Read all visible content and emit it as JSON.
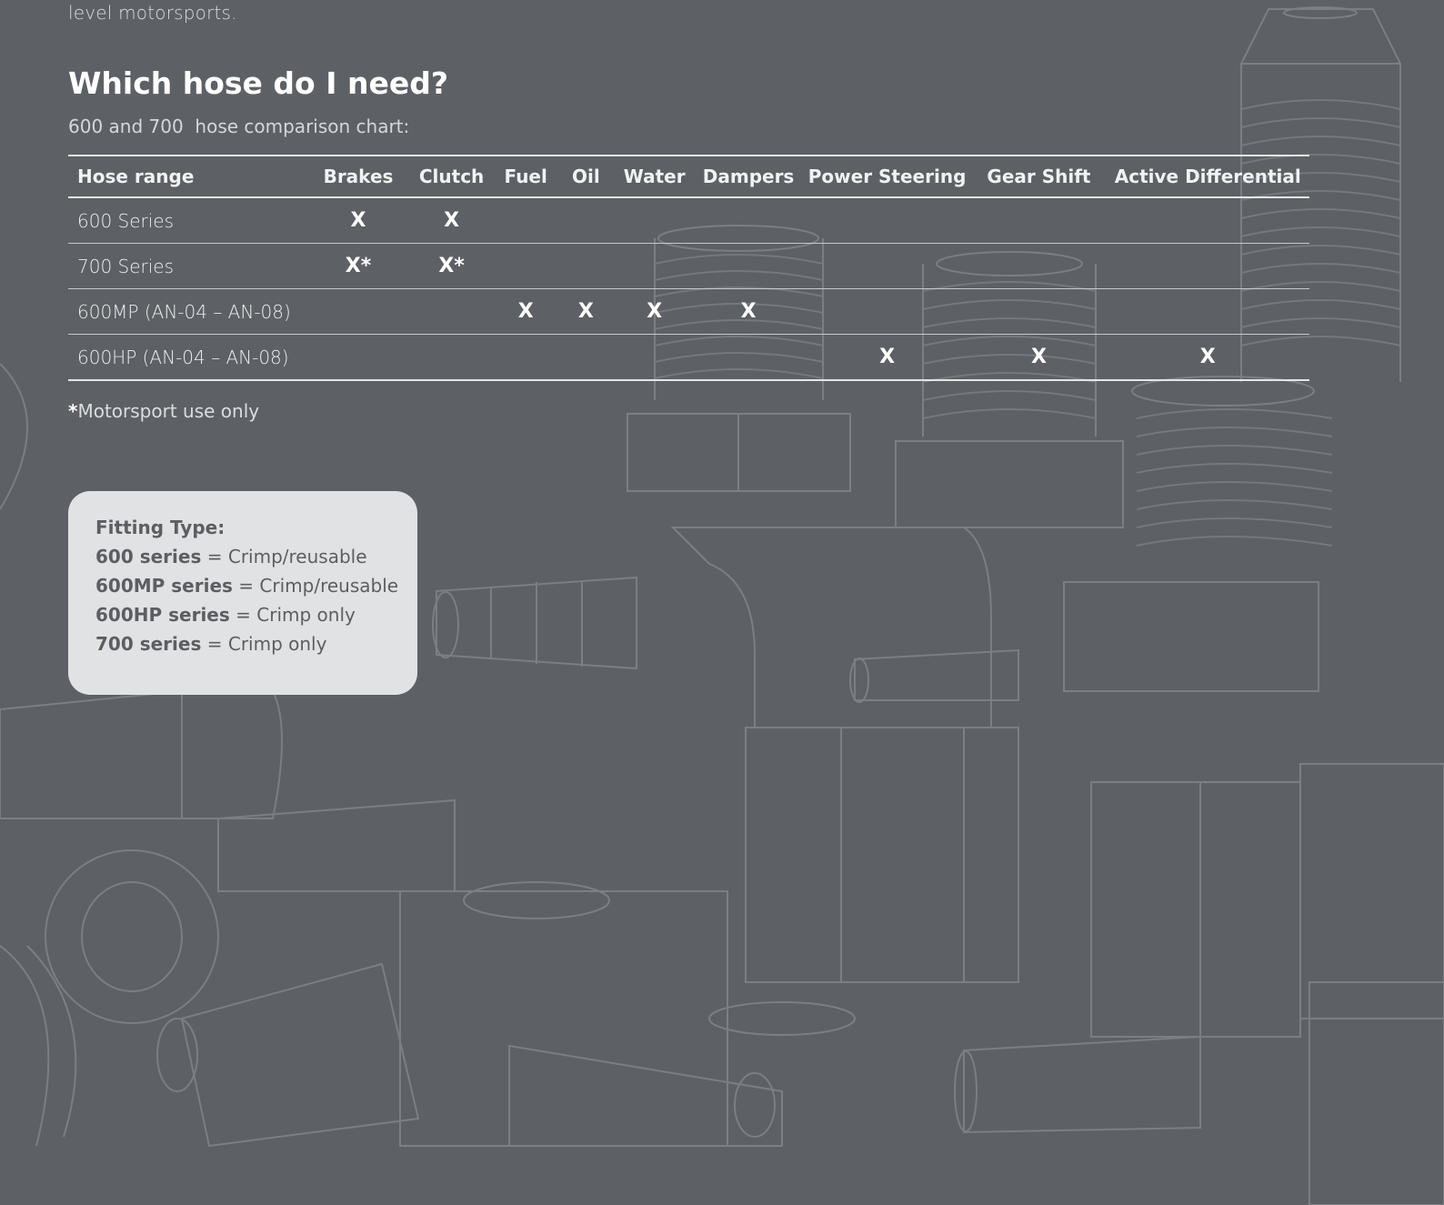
{
  "intro_text": "level motorsports.",
  "heading": "Which hose do I need?",
  "subheading": "600 and 700  hose comparison chart:",
  "table": {
    "columns": [
      "Hose range",
      "Brakes",
      "Clutch",
      "Fuel",
      "Oil",
      "Water",
      "Dampers",
      "Power Steering",
      "Gear Shift",
      "Active Differential"
    ],
    "rows": [
      {
        "name": "600 Series",
        "cells": [
          "X",
          "X",
          "",
          "",
          "",
          "",
          "",
          "",
          ""
        ]
      },
      {
        "name": "700 Series",
        "cells": [
          "X*",
          "X*",
          "",
          "",
          "",
          "",
          "",
          "",
          ""
        ]
      },
      {
        "name": "600MP (AN-04 – AN-08)",
        "cells": [
          "",
          "",
          "X",
          "X",
          "X",
          "X",
          "",
          "",
          ""
        ]
      },
      {
        "name": "600HP (AN-04 – AN-08)",
        "cells": [
          "",
          "",
          "",
          "",
          "",
          "",
          "X",
          "X",
          "X"
        ]
      }
    ]
  },
  "footnote": {
    "star": "*",
    "text": "Motorsport use only"
  },
  "fitting_box": {
    "title": "Fitting Type:",
    "items": [
      {
        "series": "600 series",
        "type": "Crimp/reusable"
      },
      {
        "series": "600MP series",
        "type": "Crimp/reusable"
      },
      {
        "series": "600HP series",
        "type": "Crimp only"
      },
      {
        "series": "700 series",
        "type": "Crimp only"
      }
    ]
  },
  "colors": {
    "background": "#5d6065",
    "box_background": "#e1e2e4",
    "line_art": "#7d8086"
  }
}
